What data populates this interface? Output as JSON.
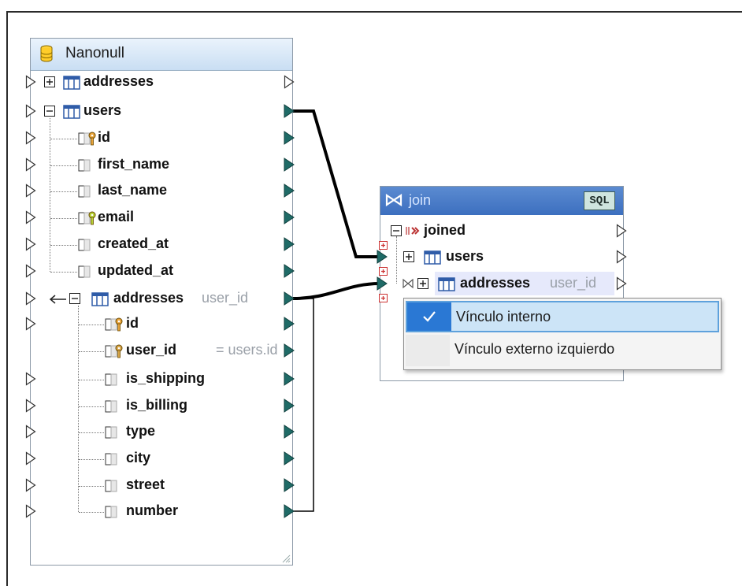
{
  "colors": {
    "connector_fill": "#1f6b67",
    "header_gradient": "#c9def3",
    "join_header": "#3c6fbf",
    "menu_highlight": "#cce4f7",
    "menu_check": "#2a78d4"
  },
  "source_component": {
    "title": "Nanonull",
    "icon": "database-icon",
    "rows": [
      {
        "label": "addresses",
        "type": "table",
        "expanded": false
      },
      {
        "label": "users",
        "type": "table",
        "expanded": true
      },
      {
        "label": "id",
        "type": "primary-key-field"
      },
      {
        "label": "first_name",
        "type": "field"
      },
      {
        "label": "last_name",
        "type": "field"
      },
      {
        "label": "email",
        "type": "unique-key-field"
      },
      {
        "label": "created_at",
        "type": "field"
      },
      {
        "label": "updated_at",
        "type": "field"
      },
      {
        "label": "addresses",
        "type": "related-table",
        "sub": "user_id"
      },
      {
        "label": "id",
        "type": "primary-key-field"
      },
      {
        "label": "user_id",
        "type": "foreign-key-field",
        "sub": "= users.id"
      },
      {
        "label": "is_shipping",
        "type": "field"
      },
      {
        "label": "is_billing",
        "type": "field"
      },
      {
        "label": "type",
        "type": "field"
      },
      {
        "label": "city",
        "type": "field"
      },
      {
        "label": "street",
        "type": "field"
      },
      {
        "label": "number",
        "type": "field"
      }
    ]
  },
  "join_component": {
    "title": "join",
    "badge": "SQL",
    "rows": [
      {
        "label": "joined"
      },
      {
        "label": "users"
      },
      {
        "label": "addresses",
        "sub": "user_id"
      }
    ]
  },
  "context_menu": {
    "items": [
      {
        "label": "Vínculo interno",
        "checked": true
      },
      {
        "label": "Vínculo externo izquierdo",
        "checked": false
      }
    ]
  }
}
